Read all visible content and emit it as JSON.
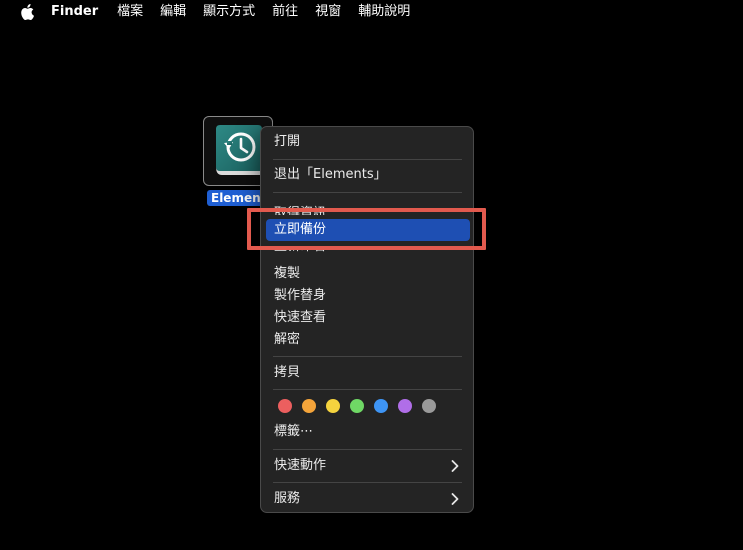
{
  "menubar": {
    "apple_icon": "apple-icon",
    "items": [
      "Finder",
      "檔案",
      "編輯",
      "顯示方式",
      "前往",
      "視窗",
      "輔助說明"
    ]
  },
  "desktop": {
    "drive": {
      "icon": "time-machine-drive-icon",
      "label": "Element"
    }
  },
  "context_menu": {
    "items": {
      "open": "打開",
      "eject": "退出「Elements」",
      "get_info": "取得資訊",
      "back_up_now": "立即備份",
      "rename": "重新命名",
      "duplicate": "複製",
      "make_alias": "製作替身",
      "quick_look": "快速查看",
      "decrypt": "解密",
      "copy": "拷貝",
      "tags": "標籤⋯",
      "quick_actions": "快速動作",
      "services": "服務"
    },
    "tag_colors": [
      "#ec5f5f",
      "#f4a43a",
      "#f5d33e",
      "#6fd865",
      "#3e95f5",
      "#b06ee8",
      "#9a9a9a"
    ],
    "highlight_color": "#1e4fb3"
  },
  "annotation": {
    "color": "#e25a4e"
  }
}
